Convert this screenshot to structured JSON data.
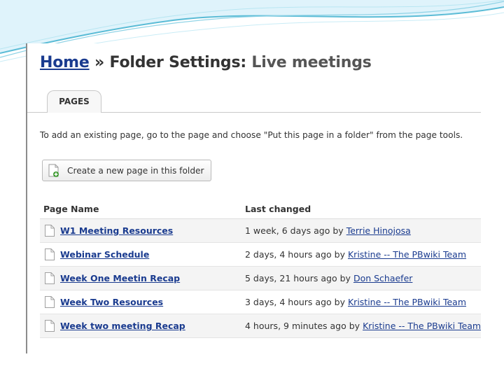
{
  "breadcrumb": {
    "home": "Home",
    "separator": "»",
    "section": "Folder Settings:",
    "folder": "Live meetings"
  },
  "tabs": [
    {
      "label": "PAGES",
      "active": true
    }
  ],
  "instructions": "To add an existing page, go to the page and choose \"Put this page in a folder\" from the page tools.",
  "create_button": {
    "label": "Create a new page in this folder",
    "icon": "new-page-icon"
  },
  "table": {
    "headers": [
      "Page Name",
      "Last changed"
    ],
    "rows": [
      {
        "name": "W1 Meeting Resources",
        "ago": "1 week, 6 days ago",
        "by": "by",
        "author": "Terrie Hinojosa"
      },
      {
        "name": "Webinar Schedule",
        "ago": "2 days, 4 hours ago",
        "by": "by",
        "author": "Kristine -- The PBwiki Team"
      },
      {
        "name": "Week One Meetin Recap",
        "ago": "5 days, 21 hours ago",
        "by": "by",
        "author": "Don Schaefer"
      },
      {
        "name": "Week Two Resources",
        "ago": "3 days, 4 hours ago",
        "by": "by",
        "author": "Kristine -- The PBwiki Team"
      },
      {
        "name": "Week two meeting Recap",
        "ago": "4 hours, 9 minutes ago",
        "by": "by",
        "author": "Kristine -- The PBwiki Team"
      }
    ]
  },
  "colors": {
    "link": "#1a3b8f",
    "swoosh_light": "#dff3fb",
    "swoosh_dark": "#5bbcd6"
  }
}
